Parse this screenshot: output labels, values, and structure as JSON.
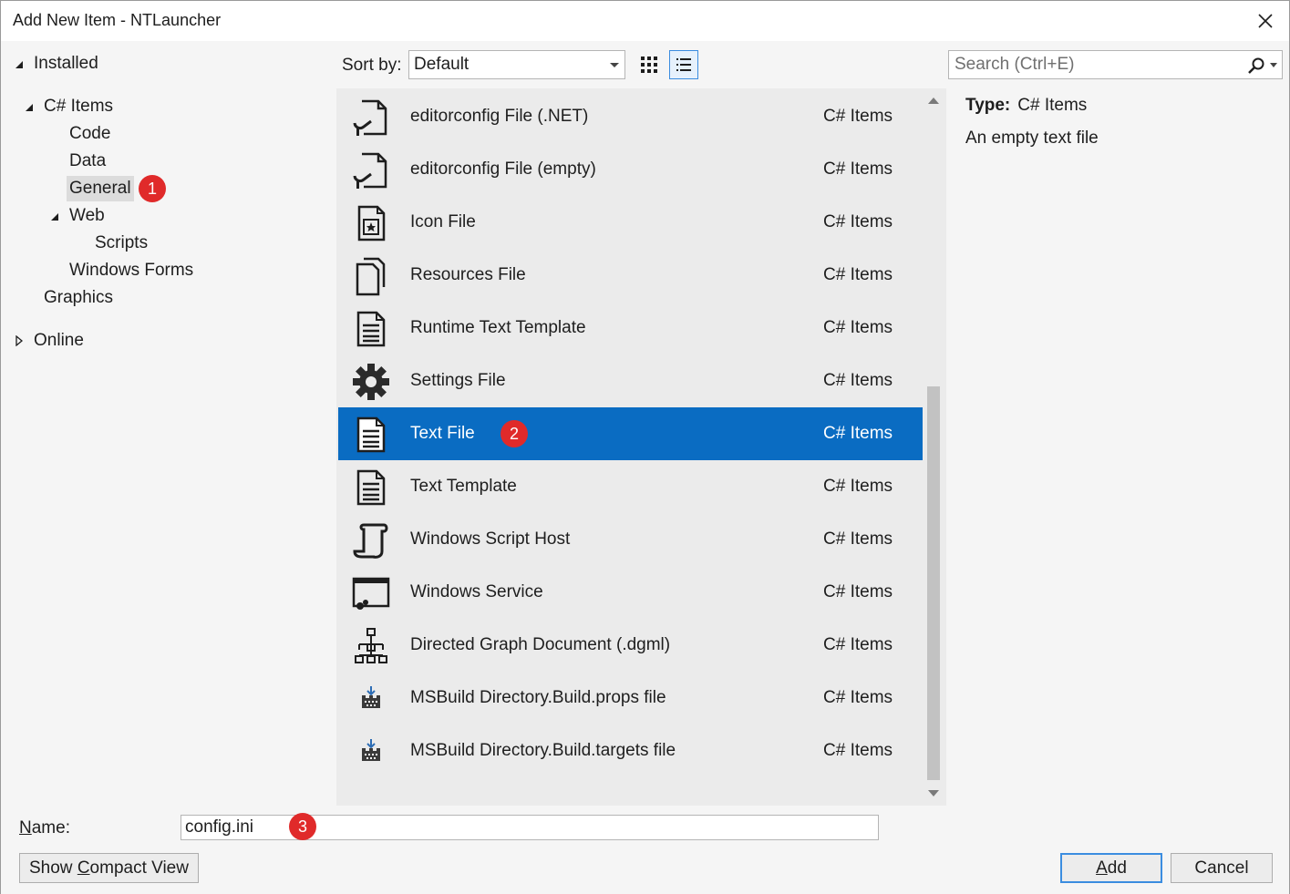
{
  "window": {
    "title": "Add New Item - NTLauncher"
  },
  "tree": {
    "installed": "Installed",
    "csharp_items": "C# Items",
    "code": "Code",
    "data": "Data",
    "general": "General",
    "web": "Web",
    "scripts": "Scripts",
    "windows_forms": "Windows Forms",
    "graphics": "Graphics",
    "online": "Online"
  },
  "badges": {
    "b1": "1",
    "b2": "2",
    "b3": "3"
  },
  "toolbar": {
    "sort_label": "Sort by:",
    "sort_value": "Default",
    "search_placeholder": "Search (Ctrl+E)"
  },
  "items": [
    {
      "name": "editorconfig File (.NET)",
      "category": "C# Items",
      "icon": "editorconfig-icon"
    },
    {
      "name": "editorconfig File (empty)",
      "category": "C# Items",
      "icon": "editorconfig-icon"
    },
    {
      "name": "Icon File",
      "category": "C# Items",
      "icon": "icon-file-icon"
    },
    {
      "name": "Resources File",
      "category": "C# Items",
      "icon": "resources-file-icon"
    },
    {
      "name": "Runtime Text Template",
      "category": "C# Items",
      "icon": "text-template-icon"
    },
    {
      "name": "Settings File",
      "category": "C# Items",
      "icon": "gear-icon"
    },
    {
      "name": "Text File",
      "category": "C# Items",
      "icon": "text-file-icon",
      "selected": true
    },
    {
      "name": "Text Template",
      "category": "C# Items",
      "icon": "text-template-icon"
    },
    {
      "name": "Windows Script Host",
      "category": "C# Items",
      "icon": "script-icon"
    },
    {
      "name": "Windows Service",
      "category": "C# Items",
      "icon": "service-icon"
    },
    {
      "name": "Directed Graph Document (.dgml)",
      "category": "C# Items",
      "icon": "graph-icon"
    },
    {
      "name": "MSBuild Directory.Build.props file",
      "category": "C# Items",
      "icon": "msbuild-icon"
    },
    {
      "name": "MSBuild Directory.Build.targets file",
      "category": "C# Items",
      "icon": "msbuild-icon"
    }
  ],
  "details": {
    "type_label": "Type:",
    "type_value": "C# Items",
    "description": "An empty text file"
  },
  "bottom": {
    "name_label_pre": "N",
    "name_label_post": "ame:",
    "name_value": "config.ini",
    "compact_pre": "Show ",
    "compact_u": "C",
    "compact_post": "ompact View",
    "add_u": "A",
    "add_post": "dd",
    "cancel": "Cancel"
  },
  "colors": {
    "selection": "#0a6cc2",
    "badge": "#e02a2a",
    "focus_border": "#3b8de0"
  }
}
